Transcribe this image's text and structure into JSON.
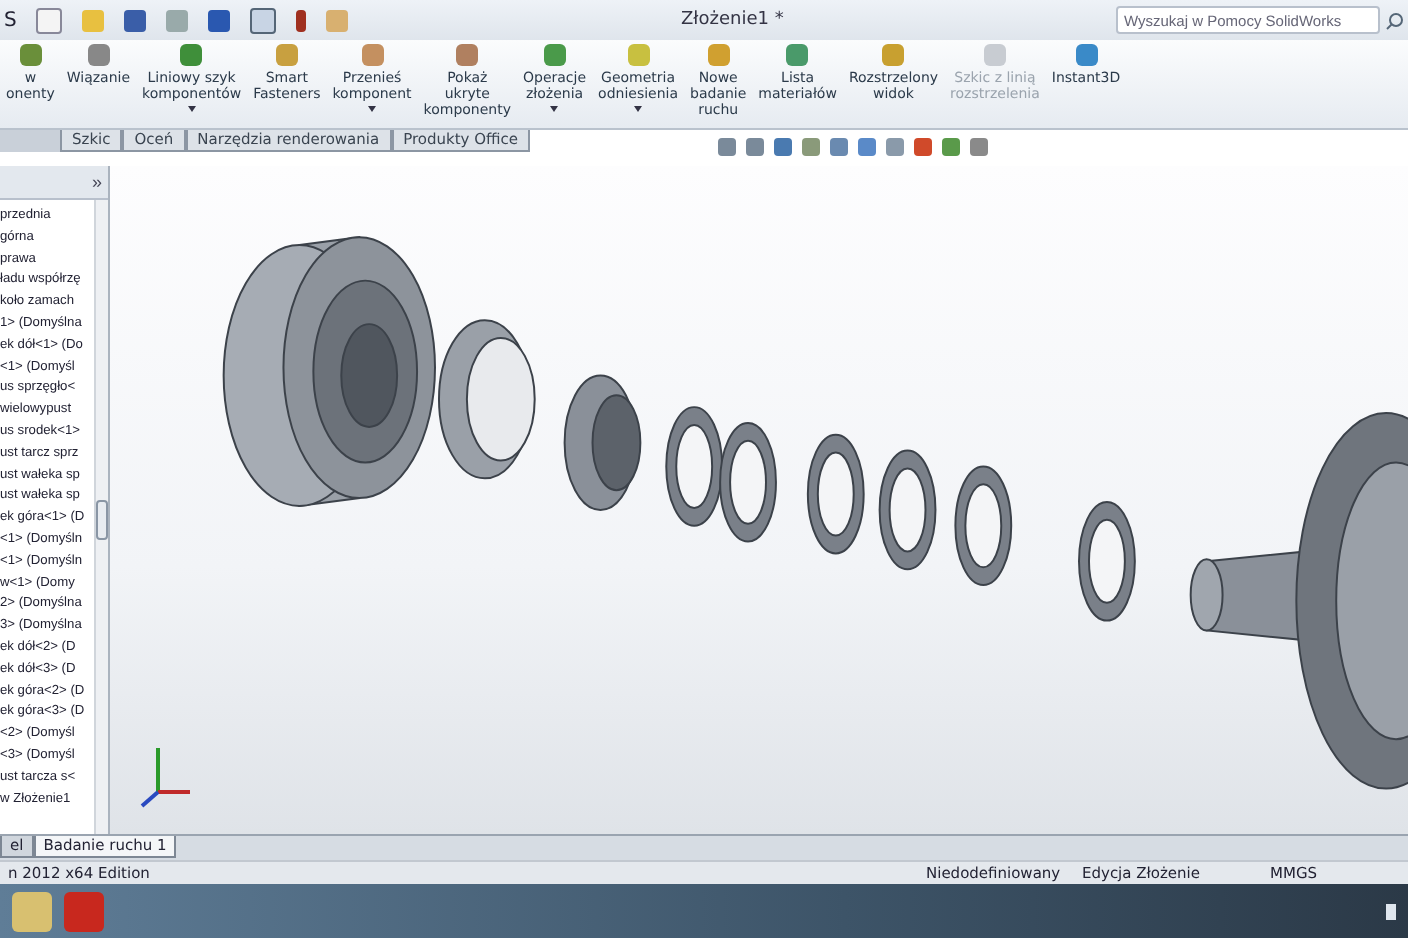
{
  "menu_fragment": "S",
  "title": "Złożenie1 *",
  "search": {
    "placeholder": "Wyszukaj w Pomocy SolidWorks"
  },
  "ribbon": [
    {
      "lines": [
        "w",
        "onenty"
      ],
      "dropdown": false,
      "disabled": false
    },
    {
      "lines": [
        "Wiązanie"
      ],
      "dropdown": false,
      "disabled": false
    },
    {
      "lines": [
        "Liniowy szyk",
        "komponentów"
      ],
      "dropdown": true,
      "disabled": false
    },
    {
      "lines": [
        "Smart",
        "Fasteners"
      ],
      "dropdown": false,
      "disabled": false
    },
    {
      "lines": [
        "Przenieś",
        "komponent"
      ],
      "dropdown": true,
      "disabled": false
    },
    {
      "lines": [
        "Pokaż",
        "ukryte",
        "komponenty"
      ],
      "dropdown": false,
      "disabled": false
    },
    {
      "lines": [
        "Operacje",
        "złożenia"
      ],
      "dropdown": true,
      "disabled": false
    },
    {
      "lines": [
        "Geometria",
        "odniesienia"
      ],
      "dropdown": true,
      "disabled": false
    },
    {
      "lines": [
        "Nowe",
        "badanie",
        "ruchu"
      ],
      "dropdown": false,
      "disabled": false
    },
    {
      "lines": [
        "Lista",
        "materiałów"
      ],
      "dropdown": false,
      "disabled": false
    },
    {
      "lines": [
        "Rozstrzelony",
        "widok"
      ],
      "dropdown": false,
      "disabled": false
    },
    {
      "lines": [
        "Szkic z linią",
        "rozstrzelenia"
      ],
      "dropdown": false,
      "disabled": true
    },
    {
      "lines": [
        "Instant3D"
      ],
      "dropdown": false,
      "disabled": false
    }
  ],
  "tabs": [
    {
      "label": "Szkic",
      "selected": false
    },
    {
      "label": "Oceń",
      "selected": false
    },
    {
      "label": "Narzędzia renderowania",
      "selected": false
    },
    {
      "label": "Produkty Office",
      "selected": false
    }
  ],
  "tree": {
    "more": "»",
    "items": [
      "przednia",
      "górna",
      "prawa",
      "ładu współrzę",
      "koło zamach",
      "1> (Domyślna",
      "ek dół<1> (Do",
      "<1> (Domyśl",
      "us sprzęgło<",
      "wielowypust",
      "us srodek<1>",
      "ust tarcz sprz",
      "ust wałeka sp",
      "ust wałeka sp",
      "ek góra<1> (D",
      "<1> (Domyśln",
      "<1> (Domyśln",
      "w<1> (Domy",
      "2> (Domyślna",
      "3> (Domyślna",
      "ek dół<2> (D",
      "ek dół<3> (D",
      "ek góra<2> (D",
      "ek góra<3> (D",
      "<2> (Domyśl",
      "<3> (Domyśl",
      "ust tarcza s<",
      "w Złożenie1"
    ]
  },
  "bottom_tabs": [
    {
      "label": "el",
      "selected": false
    },
    {
      "label": "Badanie ruchu 1",
      "selected": true
    }
  ],
  "status": {
    "edition": "n 2012 x64 Edition",
    "items": [
      "Niedodefiniowany",
      "Edycja Złożenie",
      "MMGS"
    ]
  }
}
